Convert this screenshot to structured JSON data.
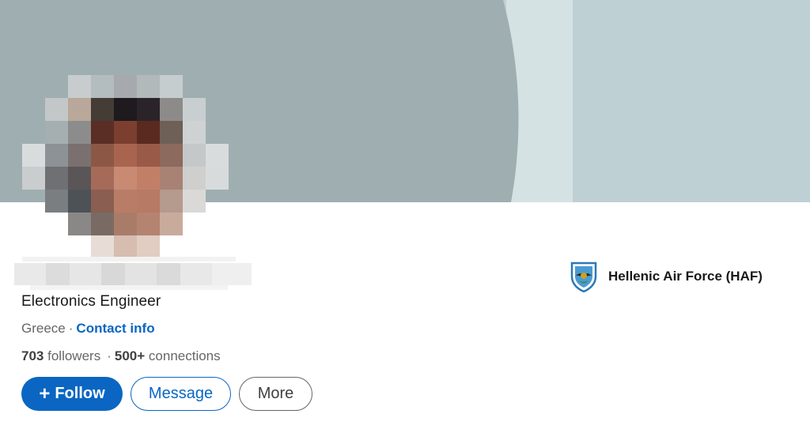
{
  "profile": {
    "headline": "Electronics Engineer",
    "location": "Greece",
    "separator": "·",
    "contact_info_label": "Contact info",
    "followers_count": "703",
    "followers_label": "followers",
    "connections_count": "500+",
    "connections_label": "connections"
  },
  "actions": {
    "follow_icon": "+",
    "follow_label": "Follow",
    "message_label": "Message",
    "more_label": "More"
  },
  "organization": {
    "name": "Hellenic Air Force (HAF)",
    "logo_icon": "hellenic-air-force-emblem"
  },
  "colors": {
    "brand_blue": "#0a66c2",
    "banner_dark": "#9faeb1",
    "banner_light": "#bfd0d4",
    "text_primary": "#191919",
    "text_secondary": "#666666"
  }
}
